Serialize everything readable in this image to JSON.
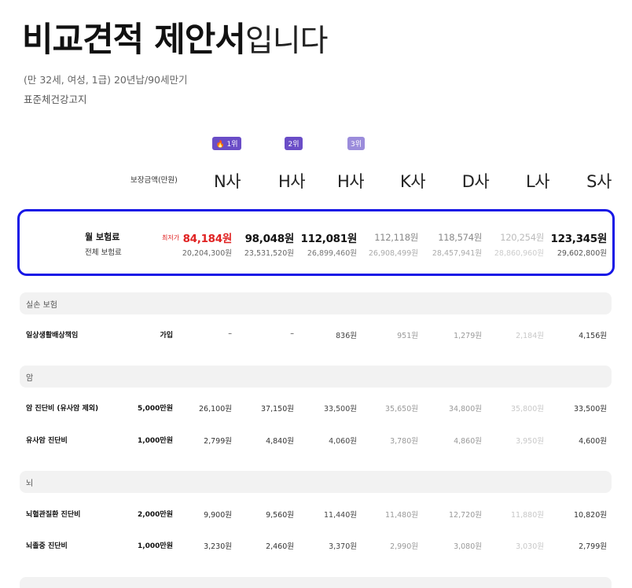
{
  "title": {
    "bold": "비교견적 제안서",
    "normal": "입니다"
  },
  "subtitle": "(만 32세, 여성, 1급) 20년납/90세만기",
  "plan_name": "표준체건강고지",
  "ranks": [
    {
      "label": "🔥 1위"
    },
    {
      "label": "2위"
    },
    {
      "label": "3위"
    }
  ],
  "header": {
    "coverage_label": "보장금액(만원)",
    "companies": [
      "N사",
      "H사",
      "H사",
      "K사",
      "D사",
      "L사",
      "S사"
    ]
  },
  "premium": {
    "monthly_label": "월 보험료",
    "total_label": "전체 보험료",
    "lowest_tag": "최저가",
    "monthly": [
      "84,184원",
      "98,048원",
      "112,081원",
      "112,118원",
      "118,574원",
      "120,254원",
      "123,345원"
    ],
    "total": [
      "20,204,300원",
      "23,531,520원",
      "26,899,460원",
      "26,908,499원",
      "28,457,941원",
      "28,860,960원",
      "29,602,800원"
    ]
  },
  "sections": [
    {
      "title": "실손 보험"
    },
    {
      "title": "암"
    },
    {
      "title": "뇌"
    }
  ],
  "rows": [
    {
      "label": "일상생활배상책임",
      "amount": "가입",
      "values": [
        "–",
        "–",
        "836원",
        "951원",
        "1,279원",
        "2,184원",
        "4,156원"
      ]
    },
    {
      "label": "암 진단비 (유사암 제외)",
      "amount": "5,000만원",
      "values": [
        "26,100원",
        "37,150원",
        "33,500원",
        "35,650원",
        "34,800원",
        "35,800원",
        "33,500원"
      ]
    },
    {
      "label": "유사암 진단비",
      "amount": "1,000만원",
      "values": [
        "2,799원",
        "4,840원",
        "4,060원",
        "3,780원",
        "4,860원",
        "3,950원",
        "4,600원"
      ]
    },
    {
      "label": "뇌혈관질환 진단비",
      "amount": "2,000만원",
      "values": [
        "9,900원",
        "9,560원",
        "11,440원",
        "11,480원",
        "12,720원",
        "11,880원",
        "10,820원"
      ]
    },
    {
      "label": "뇌졸중 진단비",
      "amount": "1,000만원",
      "values": [
        "3,230원",
        "2,460원",
        "3,370원",
        "2,990원",
        "3,080원",
        "3,030원",
        "2,799원"
      ]
    }
  ]
}
